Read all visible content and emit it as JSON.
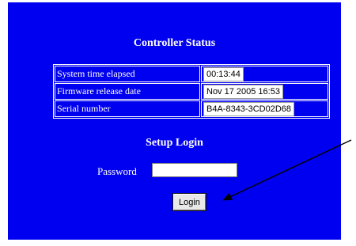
{
  "panel": {
    "background_color": "#0000f0"
  },
  "status": {
    "title": "Controller Status",
    "rows": [
      {
        "label": "System time elapsed",
        "value": "00:13:44"
      },
      {
        "label": "Firmware release date",
        "value": "Nov 17 2005 16:53"
      },
      {
        "label": "Serial number",
        "value": "B4A-8343-3CD02D68"
      }
    ]
  },
  "login": {
    "title": "Setup Login",
    "password_label": "Password",
    "password_value": "",
    "button_label": "Login"
  },
  "annotation": {
    "arrow_color": "#000000",
    "points_to": "login-button"
  }
}
